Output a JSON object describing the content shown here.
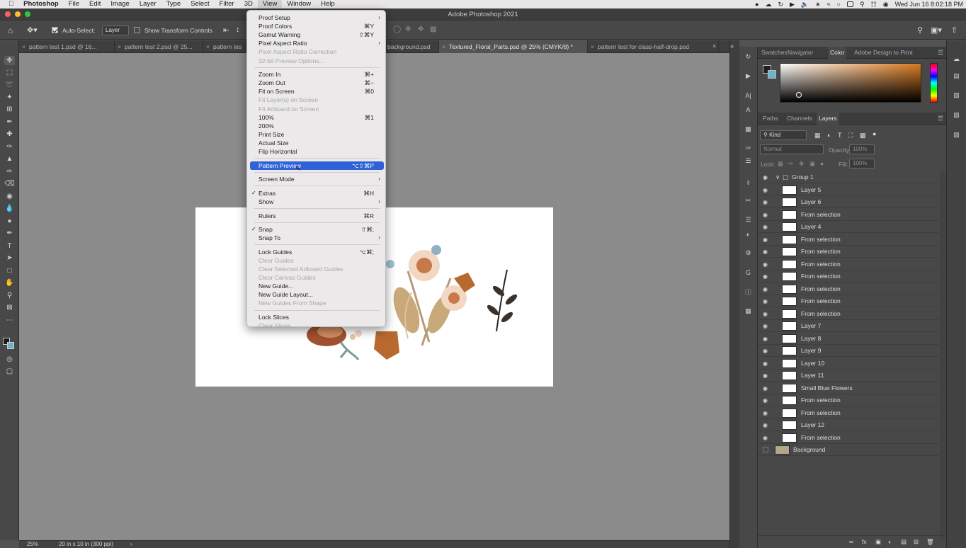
{
  "menubar": {
    "items": [
      "Photoshop",
      "File",
      "Edit",
      "Image",
      "Layer",
      "Type",
      "Select",
      "Filter",
      "3D",
      "View",
      "Window",
      "Help"
    ],
    "clock": "Wed Jun 16  8:02:18 PM"
  },
  "window": {
    "title": "Adobe Photoshop 2021"
  },
  "options_bar": {
    "auto_select_label": "Auto-Select:",
    "auto_select_value": "Layer",
    "transform_label": "Show Transform Controls"
  },
  "tabs": [
    {
      "label": "pattern test 1.psd @ 16..."
    },
    {
      "label": "pattern test 2.psd @ 25..."
    },
    {
      "label": "pattern tes"
    },
    {
      "label": "background.psd"
    },
    {
      "label": "Textured_Floral_Parts.psd @ 25% (CMYK/8) *"
    },
    {
      "label": "pattern test for class-half-drop.psd"
    }
  ],
  "status": {
    "zoom": "25%",
    "doc_size": "20 in x 10 in (300 ppi)"
  },
  "view_menu": {
    "items": [
      {
        "label": "Proof Setup",
        "shortcut": "",
        "submenu": true
      },
      {
        "label": "Proof Colors",
        "shortcut": "⌘Y"
      },
      {
        "label": "Gamut Warning",
        "shortcut": "⇧⌘Y"
      },
      {
        "label": "Pixel Aspect Ratio",
        "shortcut": "",
        "submenu": true
      },
      {
        "label": "Pixel Aspect Ratio Correction",
        "shortcut": "",
        "disabled": true
      },
      {
        "label": "32-bit Preview Options...",
        "shortcut": "",
        "disabled": true
      },
      {
        "label": "Zoom In",
        "shortcut": "⌘+"
      },
      {
        "label": "Zoom Out",
        "shortcut": "⌘−"
      },
      {
        "label": "Fit on Screen",
        "shortcut": "⌘0"
      },
      {
        "label": "Fit Layer(s) on Screen",
        "shortcut": "",
        "disabled": true
      },
      {
        "label": "Fit Artboard on Screen",
        "shortcut": "",
        "disabled": true
      },
      {
        "label": "100%",
        "shortcut": "⌘1"
      },
      {
        "label": "200%",
        "shortcut": ""
      },
      {
        "label": "Print Size",
        "shortcut": ""
      },
      {
        "label": "Actual Size",
        "shortcut": ""
      },
      {
        "label": "Flip Horizontal",
        "shortcut": ""
      },
      {
        "label": "Pattern Preview",
        "shortcut": "⌥⇧⌘P",
        "highlighted": true
      },
      {
        "label": "Screen Mode",
        "shortcut": "",
        "submenu": true
      },
      {
        "label": "Extras",
        "shortcut": "⌘H",
        "checked": true
      },
      {
        "label": "Show",
        "shortcut": "",
        "submenu": true
      },
      {
        "label": "Rulers",
        "shortcut": "⌘R"
      },
      {
        "label": "Snap",
        "shortcut": "⇧⌘;",
        "checked": true
      },
      {
        "label": "Snap To",
        "shortcut": "",
        "submenu": true
      },
      {
        "label": "Lock Guides",
        "shortcut": "⌥⌘;"
      },
      {
        "label": "Clear Guides",
        "shortcut": "",
        "disabled": true
      },
      {
        "label": "Clear Selected Artboard Guides",
        "shortcut": "",
        "disabled": true
      },
      {
        "label": "Clear Canvas Guides",
        "shortcut": "",
        "disabled": true
      },
      {
        "label": "New Guide...",
        "shortcut": ""
      },
      {
        "label": "New Guide Layout...",
        "shortcut": ""
      },
      {
        "label": "New Guides From Shape",
        "shortcut": "",
        "disabled": true
      },
      {
        "label": "Lock Slices",
        "shortcut": ""
      },
      {
        "label": "Clear Slices",
        "shortcut": "",
        "disabled": true
      }
    ]
  },
  "color_panel": {
    "tabs": [
      "Swatches",
      "Navigator",
      "Color",
      "Adobe Design to Print"
    ],
    "active_tab": "Color"
  },
  "layers_panel": {
    "tabs": [
      "Paths",
      "Channels",
      "Layers"
    ],
    "active_tab": "Layers",
    "filter_kind": "Kind",
    "blend_mode": "Normal",
    "opacity_label": "Opacity:",
    "opacity_value": "100%",
    "lock_label": "Lock:",
    "fill_label": "Fill:",
    "fill_value": "100%",
    "group_name": "Group 1",
    "layers": [
      "Layer 5",
      "Layer 6",
      "From selection",
      "Layer 4",
      "From selection",
      "From selection",
      "From selection",
      "From selection",
      "From selection",
      "From selection",
      "From selection",
      "Layer 7",
      "Layer 8",
      "Layer 9",
      "Layer 10",
      "Layer 11",
      "Small Blue Flowers",
      "From selection",
      "From selection",
      "Layer 12",
      "From selection"
    ],
    "background_name": "Background"
  }
}
